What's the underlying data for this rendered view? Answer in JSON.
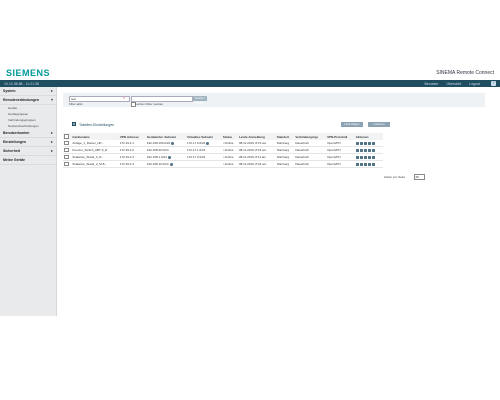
{
  "header": {
    "brand": "SIEMENS",
    "app_title": "SINEMA Remote Connect"
  },
  "topbar": {
    "left_text": "10.10.38.88 - 11:21:38",
    "links": [
      "Benutzer",
      "Übersicht",
      "Logout"
    ],
    "help": "?"
  },
  "sidebar": {
    "items": [
      {
        "label": "System",
        "bold": true
      },
      {
        "label": "Remoteverbindungen",
        "bold": true
      },
      {
        "label": "Geräte",
        "sub": true
      },
      {
        "label": "Gerätegruppen",
        "sub": true
      },
      {
        "label": "Verbindungsgruppen",
        "sub": true
      },
      {
        "label": "Netzwerkverbindungen",
        "sub": true
      },
      {
        "label": "Benutzerkonten",
        "bold": true
      },
      {
        "label": "Einstellungen",
        "bold": true
      },
      {
        "label": "Sicherheit",
        "bold": true
      },
      {
        "label": "Meine Geräte",
        "bold": true
      }
    ]
  },
  "filter": {
    "search_value": "test",
    "clear": "×",
    "button": "Suche / Filter",
    "label": "Filter aktiv",
    "remember_label": "Letzten Filter merken"
  },
  "section": {
    "link": "Tabellen-Einstellungen",
    "btn1": "Hinzufügen",
    "btn2": "Löschen"
  },
  "table": {
    "headers": [
      "",
      "Gerätename",
      "VPN-Adresse",
      "Geräteinter. Subnetz",
      "Virtuelles Subnetz",
      "Status",
      "Letzte Anmeldung",
      "Standort",
      "Verbindungstyp",
      "VPN-Protokoll",
      "Aktionen"
    ],
    "rows": [
      {
        "name": "Anlage_1_Router_HP...",
        "vpn": "172.19.4.1",
        "sub": "192.168.100.0/24",
        "virt": "172.17.0.0/24",
        "status": "Online",
        "last": "08.11.2019, 8:15 am",
        "loc": "Nürnberg",
        "type": "Dauerhaft",
        "proto": "OpenVPN"
      },
      {
        "name": "Kreuzer_Switch_ABT-3_R",
        "vpn": "172.19.4.2",
        "sub": "192.168.20.0/24",
        "virt": "172.17.1.0/24",
        "status": "Online",
        "last": "08.11.2019, 8:15 am",
        "loc": "Nürnberg",
        "type": "Dauerhaft",
        "proto": "OpenVPN"
      },
      {
        "name": "Scalance_Stand_3_R...",
        "vpn": "172.19.4.3",
        "sub": "192.168.1.0/24",
        "virt": "172.17.2.0/24",
        "status": "Online",
        "last": "08.11.2019, 8:11 am",
        "loc": "Nürnberg",
        "type": "Dauerhaft",
        "proto": "OpenVPN"
      },
      {
        "name": "Scalance_Stand_2_M-8...",
        "vpn": "172.19.4.4",
        "sub": "192.168.10.0/24",
        "virt": "",
        "status": "Online",
        "last": "08.11.2019, 8:23 am",
        "loc": "Nürnberg",
        "type": "Dauerhaft",
        "proto": "OpenVPN"
      }
    ]
  },
  "pager": {
    "label": "Zeilen pro Seite",
    "value": "25"
  }
}
